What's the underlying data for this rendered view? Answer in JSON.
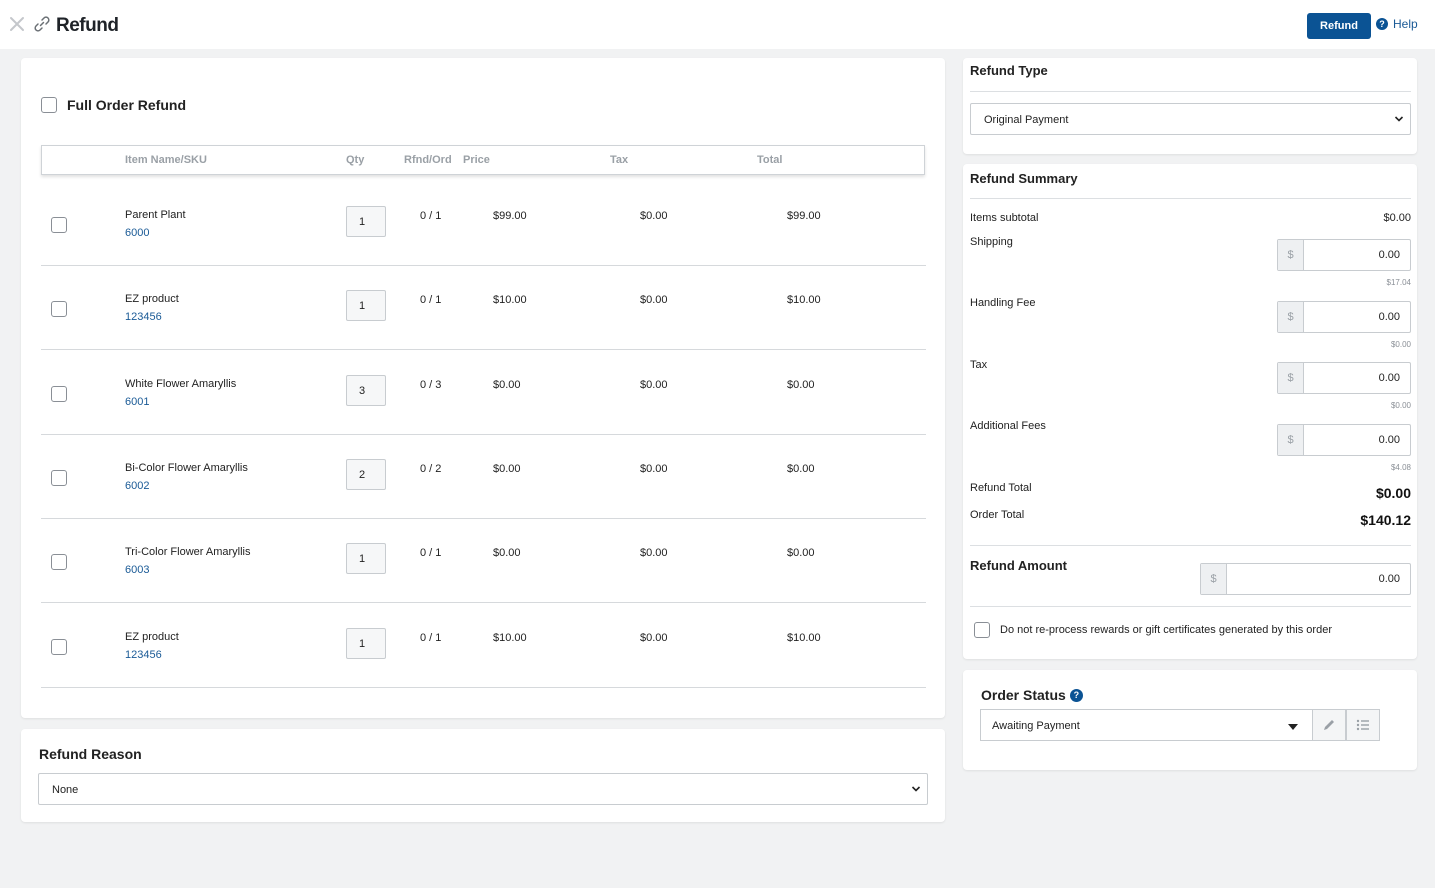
{
  "header": {
    "title": "Refund",
    "refund_button": "Refund",
    "help_label": "Help"
  },
  "items": {
    "full_order_label": "Full Order Refund",
    "columns": [
      "Item Name/SKU",
      "Qty",
      "Rfnd/Ord",
      "Price",
      "Tax",
      "Total"
    ],
    "rows": [
      {
        "name": "Parent Plant",
        "sku": "6000",
        "qty": "1",
        "rfnd": "0 / 1",
        "price": "$99.00",
        "tax": "$0.00",
        "total": "$99.00"
      },
      {
        "name": "EZ product",
        "sku": "123456",
        "qty": "1",
        "rfnd": "0 / 1",
        "price": "$10.00",
        "tax": "$0.00",
        "total": "$10.00"
      },
      {
        "name": "White Flower Amaryllis",
        "sku": "6001",
        "qty": "3",
        "rfnd": "0 / 3",
        "price": "$0.00",
        "tax": "$0.00",
        "total": "$0.00"
      },
      {
        "name": "Bi-Color Flower Amaryllis",
        "sku": "6002",
        "qty": "2",
        "rfnd": "0 / 2",
        "price": "$0.00",
        "tax": "$0.00",
        "total": "$0.00"
      },
      {
        "name": "Tri-Color Flower Amaryllis",
        "sku": "6003",
        "qty": "1",
        "rfnd": "0 / 1",
        "price": "$0.00",
        "tax": "$0.00",
        "total": "$0.00"
      },
      {
        "name": "EZ product",
        "sku": "123456",
        "qty": "1",
        "rfnd": "0 / 1",
        "price": "$10.00",
        "tax": "$0.00",
        "total": "$10.00"
      }
    ]
  },
  "reason": {
    "label": "Refund Reason",
    "value": "None"
  },
  "refund_type": {
    "label": "Refund Type",
    "value": "Original Payment"
  },
  "summary": {
    "label": "Refund Summary",
    "items_subtotal_label": "Items subtotal",
    "items_subtotal_value": "$0.00",
    "currency_symbol": "$",
    "shipping_label": "Shipping",
    "shipping_value": "0.00",
    "shipping_hint": "$17.04",
    "handling_label": "Handling Fee",
    "handling_value": "0.00",
    "handling_hint": "$0.00",
    "tax_label": "Tax",
    "tax_value": "0.00",
    "tax_hint": "$0.00",
    "additional_label": "Additional Fees",
    "additional_value": "0.00",
    "additional_hint": "$4.08",
    "refund_total_label": "Refund Total",
    "refund_total_value": "$0.00",
    "order_total_label": "Order Total",
    "order_total_value": "$140.12",
    "refund_amount_label": "Refund Amount",
    "refund_amount_value": "0.00",
    "no_reprocess_label": "Do not re-process rewards or gift certificates generated by this order"
  },
  "order_status": {
    "label": "Order Status",
    "value": "Awaiting Payment"
  },
  "colors": {
    "primary": "#0b5394",
    "link": "#1a5a96",
    "background": "#f1f2f3"
  }
}
